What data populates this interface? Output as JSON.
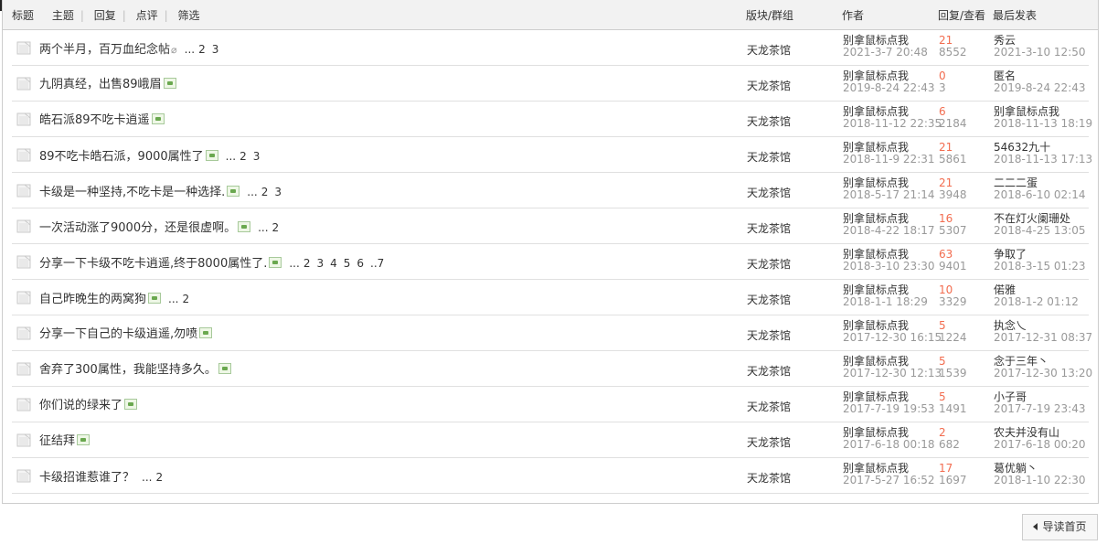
{
  "header": {
    "title_label": "标题",
    "filters": [
      "主题",
      "回复",
      "点评",
      "筛选"
    ],
    "col_forum": "版块/群组",
    "col_author": "作者",
    "col_replies": "回复/查看",
    "col_last": "最后发表"
  },
  "threads": [
    {
      "title": "两个半月，百万血纪念帖",
      "clip": true,
      "att": false,
      "pages": [
        "2",
        "3"
      ],
      "forum": "天龙茶馆",
      "author": "别拿鼠标点我",
      "date": "2021-3-7 20:48",
      "replies": "21",
      "views": "8552",
      "last_user": "秀云",
      "last_date": "2021-3-10 12:50"
    },
    {
      "title": "九阴真经，出售89峨眉",
      "clip": false,
      "att": true,
      "pages": [],
      "forum": "天龙茶馆",
      "author": "别拿鼠标点我",
      "date": "2019-8-24 22:43",
      "replies": "0",
      "views": "3",
      "last_user": "匿名",
      "last_date": "2019-8-24 22:43"
    },
    {
      "title": "皓石派89不吃卡逍遥",
      "clip": false,
      "att": true,
      "pages": [],
      "forum": "天龙茶馆",
      "author": "别拿鼠标点我",
      "date": "2018-11-12 22:35",
      "replies": "6",
      "views": "2184",
      "last_user": "别拿鼠标点我",
      "last_date": "2018-11-13 18:19"
    },
    {
      "title": "89不吃卡皓石派，9000属性了",
      "clip": false,
      "att": true,
      "pages": [
        "2",
        "3"
      ],
      "forum": "天龙茶馆",
      "author": "别拿鼠标点我",
      "date": "2018-11-9 22:31",
      "replies": "21",
      "views": "5861",
      "last_user": "54632九十",
      "last_date": "2018-11-13 17:13"
    },
    {
      "title": "卡级是一种坚持,不吃卡是一种选择.",
      "clip": false,
      "att": true,
      "pages": [
        "2",
        "3"
      ],
      "forum": "天龙茶馆",
      "author": "别拿鼠标点我",
      "date": "2018-5-17 21:14",
      "replies": "21",
      "views": "3948",
      "last_user": "二二二蛋",
      "last_date": "2018-6-10 02:14"
    },
    {
      "title": "一次活动涨了9000分，还是很虚啊。",
      "clip": false,
      "att": true,
      "pages": [
        "2"
      ],
      "forum": "天龙茶馆",
      "author": "别拿鼠标点我",
      "date": "2018-4-22 18:17",
      "replies": "16",
      "views": "5307",
      "last_user": "不在灯火阑珊处",
      "last_date": "2018-4-25 13:05"
    },
    {
      "title": "分享一下卡级不吃卡逍遥,终于8000属性了.",
      "clip": false,
      "att": true,
      "pages": [
        "2",
        "3",
        "4",
        "5",
        "6",
        "..7"
      ],
      "forum": "天龙茶馆",
      "author": "别拿鼠标点我",
      "date": "2018-3-10 23:30",
      "replies": "63",
      "views": "9401",
      "last_user": "争取了",
      "last_date": "2018-3-15 01:23"
    },
    {
      "title": "自己昨晚生的两窝狗",
      "clip": false,
      "att": true,
      "pages": [
        "2"
      ],
      "forum": "天龙茶馆",
      "author": "别拿鼠标点我",
      "date": "2018-1-1 18:29",
      "replies": "10",
      "views": "3329",
      "last_user": "偌雅",
      "last_date": "2018-1-2 01:12"
    },
    {
      "title": "分享一下自己的卡级逍遥,勿喷",
      "clip": false,
      "att": true,
      "pages": [],
      "forum": "天龙茶馆",
      "author": "别拿鼠标点我",
      "date": "2017-12-30 16:15",
      "replies": "5",
      "views": "1224",
      "last_user": "执念乀",
      "last_date": "2017-12-31 08:37"
    },
    {
      "title": "舍弃了300属性，我能坚持多久。",
      "clip": false,
      "att": true,
      "pages": [],
      "forum": "天龙茶馆",
      "author": "别拿鼠标点我",
      "date": "2017-12-30 12:13",
      "replies": "5",
      "views": "1539",
      "last_user": "念于三年丶",
      "last_date": "2017-12-30 13:20"
    },
    {
      "title": "你们说的绿来了",
      "clip": false,
      "att": true,
      "pages": [],
      "forum": "天龙茶馆",
      "author": "别拿鼠标点我",
      "date": "2017-7-19 19:53",
      "replies": "5",
      "views": "1491",
      "last_user": "小子哥",
      "last_date": "2017-7-19 23:43"
    },
    {
      "title": "征结拜",
      "clip": false,
      "att": true,
      "pages": [],
      "forum": "天龙茶馆",
      "author": "别拿鼠标点我",
      "date": "2017-6-18 00:18",
      "replies": "2",
      "views": "682",
      "last_user": "农夫并没有山",
      "last_date": "2017-6-18 00:20"
    },
    {
      "title": "卡级招谁惹谁了？",
      "clip": false,
      "att": false,
      "pages": [
        "2"
      ],
      "forum": "天龙茶馆",
      "author": "别拿鼠标点我",
      "date": "2017-5-27 16:52",
      "replies": "17",
      "views": "1697",
      "last_user": "葛优躺丶",
      "last_date": "2018-1-10 22:30"
    }
  ],
  "guide_button": "导读首页",
  "colors": {
    "reply_count": "#f26c4f",
    "muted": "#999999",
    "header_bg": "#f2f2f2"
  }
}
